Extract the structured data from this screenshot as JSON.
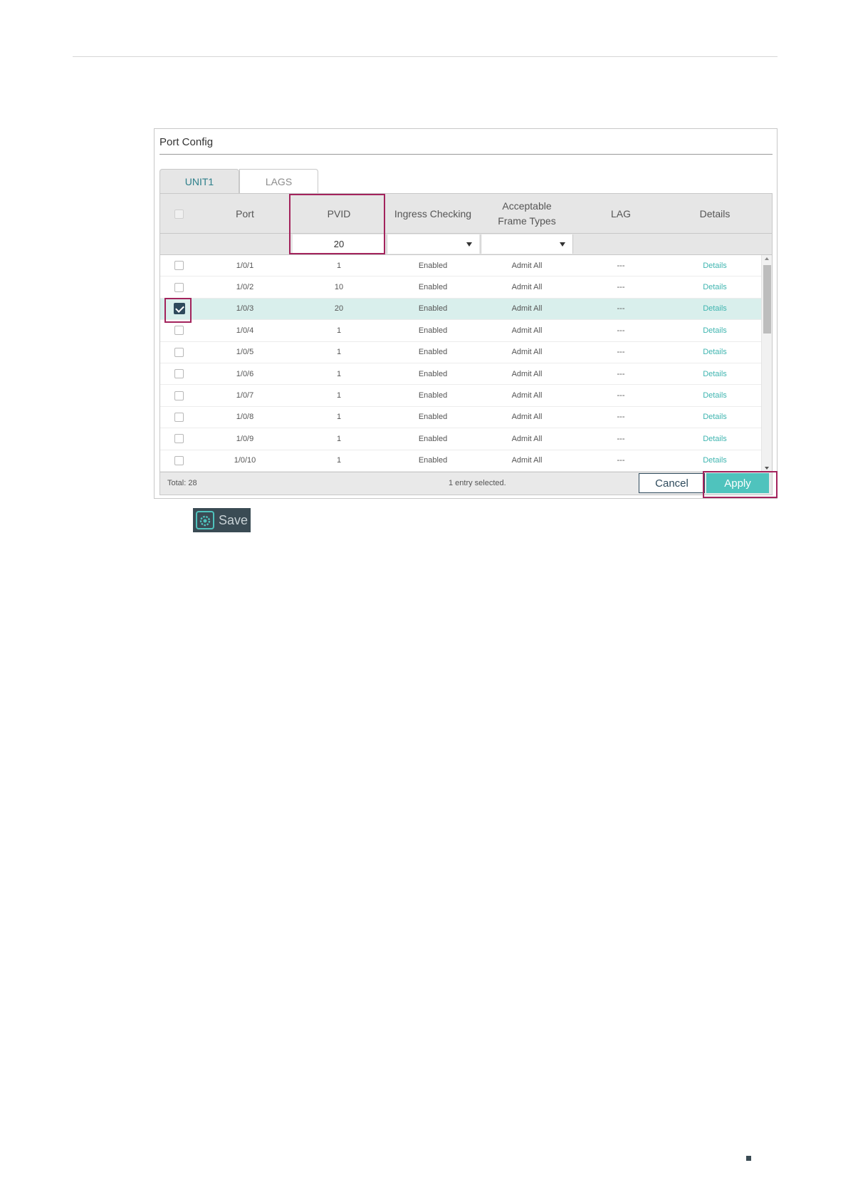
{
  "panel": {
    "title": "Port Config"
  },
  "tabs": [
    {
      "label": "UNIT1"
    },
    {
      "label": "LAGS"
    }
  ],
  "columns": {
    "port": "Port",
    "pvid": "PVID",
    "ingress": "Ingress Checking",
    "frame_types": "Acceptable Frame Types",
    "lag": "LAG",
    "details": "Details"
  },
  "filter": {
    "pvid_value": "20",
    "ingress_value": "",
    "frame_value": ""
  },
  "rows": [
    {
      "port": "1/0/1",
      "pvid": "1",
      "ingress": "Enabled",
      "frame": "Admit All",
      "lag": "---",
      "details": "Details",
      "checked": false
    },
    {
      "port": "1/0/2",
      "pvid": "10",
      "ingress": "Enabled",
      "frame": "Admit All",
      "lag": "---",
      "details": "Details",
      "checked": false
    },
    {
      "port": "1/0/3",
      "pvid": "20",
      "ingress": "Enabled",
      "frame": "Admit All",
      "lag": "---",
      "details": "Details",
      "checked": true
    },
    {
      "port": "1/0/4",
      "pvid": "1",
      "ingress": "Enabled",
      "frame": "Admit All",
      "lag": "---",
      "details": "Details",
      "checked": false
    },
    {
      "port": "1/0/5",
      "pvid": "1",
      "ingress": "Enabled",
      "frame": "Admit All",
      "lag": "---",
      "details": "Details",
      "checked": false
    },
    {
      "port": "1/0/6",
      "pvid": "1",
      "ingress": "Enabled",
      "frame": "Admit All",
      "lag": "---",
      "details": "Details",
      "checked": false
    },
    {
      "port": "1/0/7",
      "pvid": "1",
      "ingress": "Enabled",
      "frame": "Admit All",
      "lag": "---",
      "details": "Details",
      "checked": false
    },
    {
      "port": "1/0/8",
      "pvid": "1",
      "ingress": "Enabled",
      "frame": "Admit All",
      "lag": "---",
      "details": "Details",
      "checked": false
    },
    {
      "port": "1/0/9",
      "pvid": "1",
      "ingress": "Enabled",
      "frame": "Admit All",
      "lag": "---",
      "details": "Details",
      "checked": false
    },
    {
      "port": "1/0/10",
      "pvid": "1",
      "ingress": "Enabled",
      "frame": "Admit All",
      "lag": "---",
      "details": "Details",
      "checked": false
    }
  ],
  "footer": {
    "total": "Total: 28",
    "selected": "1 entry selected."
  },
  "buttons": {
    "cancel": "Cancel",
    "apply": "Apply",
    "save": "Save"
  },
  "icons": {
    "save": "gear-icon",
    "sort_caret": "caret-down-icon"
  },
  "colors": {
    "accent": "#4fc3bd",
    "link": "#3fb5b0",
    "highlight_box": "#a3235c",
    "selected_row": "#d9efec",
    "dark": "#2e4a5c"
  }
}
